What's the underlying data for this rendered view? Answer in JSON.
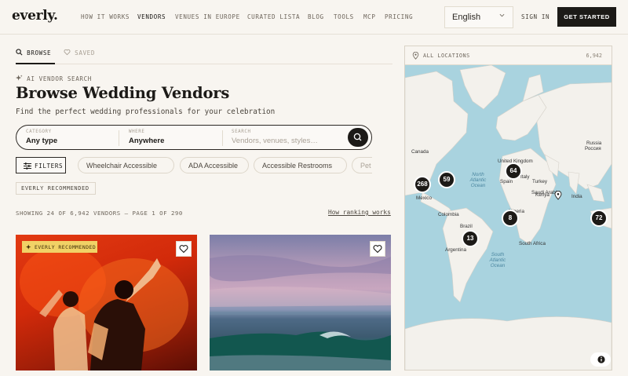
{
  "header": {
    "logo": "everly.",
    "nav": [
      "HOW IT WORKS",
      "VENDORS",
      "VENUES IN EUROPE",
      "CURATED LISTA",
      "BLOG",
      "TOOLS",
      "MCP",
      "PRICING"
    ],
    "language": "English",
    "signin": "SIGN IN",
    "get_started": "GET STARTED"
  },
  "tabs": {
    "browse": "BROWSE",
    "saved": "SAVED"
  },
  "hero": {
    "ai_label": "AI VENDOR SEARCH",
    "title": "Browse Wedding Vendors",
    "subtitle": "Find the perfect wedding professionals for your celebration"
  },
  "search": {
    "category_label": "CATEGORY",
    "category_value": "Any type",
    "where_label": "WHERE",
    "where_value": "Anywhere",
    "search_label": "SEARCH",
    "search_placeholder": "Vendors, venues, styles…"
  },
  "filters": {
    "button": "FILTERS",
    "chips": [
      "Wheelchair Accessible",
      "ADA Accessible",
      "Accessible Restrooms",
      "Pet"
    ],
    "recommended": "EVERLY RECOMMENDED"
  },
  "results": {
    "summary": "SHOWING 24 OF 6,942 VENDORS — PAGE 1 OF 290",
    "ranking_link": "How ranking works"
  },
  "cards": [
    {
      "badge": "EVERLY RECOMMENDED"
    },
    {}
  ],
  "map": {
    "header": "ALL LOCATIONS",
    "count": "6,942",
    "clusters": [
      "268",
      "59",
      "64",
      "8",
      "13",
      "72"
    ],
    "labels": [
      "United Kingdom",
      "Russia",
      "Россия",
      "Canada",
      "Spain",
      "Italy",
      "Turkey",
      "Saudi Arabia",
      "India",
      "Mexico",
      "Colombia",
      "Nigeria",
      "Kenya",
      "Brazil",
      "Argentina",
      "South Africa"
    ],
    "oceans": {
      "north_atlantic": "North Atlantic Ocean",
      "south_atlantic": "South Atlantic Ocean"
    }
  }
}
